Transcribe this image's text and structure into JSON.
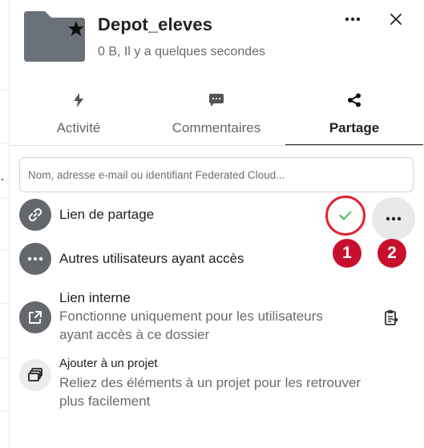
{
  "header": {
    "title": "Depot_eleves",
    "subtitle": "0 B, Il y a quelques secondes",
    "folder_icon": "folder-icon",
    "favorite_icon": "star-icon",
    "more_icon": "more-horizontal-icon",
    "close_icon": "close-icon"
  },
  "tabs": [
    {
      "label": "Activité",
      "icon": "lightning-icon",
      "active": false
    },
    {
      "label": "Commentaires",
      "icon": "comment-icon",
      "active": false
    },
    {
      "label": "Partage",
      "icon": "share-icon",
      "active": true
    }
  ],
  "search": {
    "placeholder": "Nom, adresse e-mail ou identifiant Federated Cloud...",
    "value": ""
  },
  "share_link": {
    "label": "Lien de partage",
    "icon": "link-icon",
    "confirm_icon": "checkmark-icon",
    "menu_icon": "more-horizontal-icon"
  },
  "annotations": {
    "badge_1": "1",
    "badge_2": "2"
  },
  "other_users": {
    "label": "Autres utilisateurs ayant accès",
    "icon": "more-horizontal-icon"
  },
  "internal_link": {
    "label": "Lien interne",
    "description_line1": "Fonctionne uniquement pour les utilisateurs",
    "description_line2": "ayant accès à ce dossier",
    "icon": "external-link-icon",
    "copy_icon": "clipboard-icon"
  },
  "project": {
    "label": "Ajouter à un projet",
    "description_line1": "Reliez des éléments à un projet pour les retrouver",
    "description_line2": "plus facilement",
    "icon": "projects-icon"
  },
  "colors": {
    "accent_red": "#c8102e",
    "check_green": "#46ba61",
    "avatar_grey": "#64676b",
    "text": "#222222",
    "muted_text": "#6b6b6b"
  }
}
